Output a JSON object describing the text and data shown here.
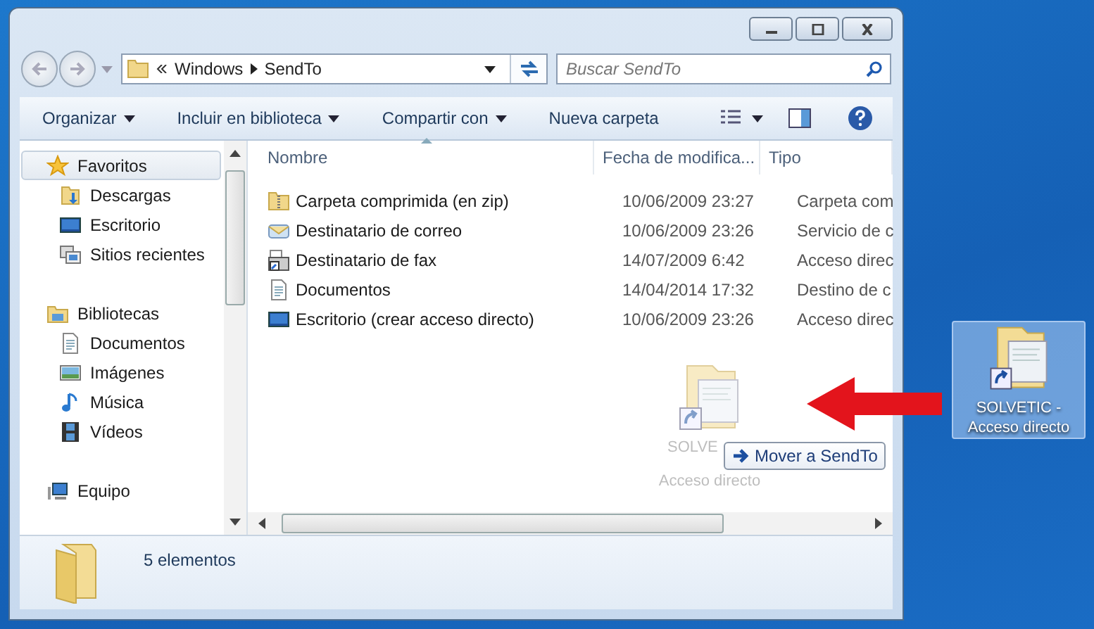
{
  "address": {
    "path": [
      "Windows",
      "SendTo"
    ]
  },
  "search": {
    "placeholder": "Buscar SendTo"
  },
  "toolbar": [
    {
      "label": "Organizar",
      "dropdown": true
    },
    {
      "label": "Incluir en biblioteca",
      "dropdown": true
    },
    {
      "label": "Compartir con",
      "dropdown": true
    },
    {
      "label": "Nueva carpeta",
      "dropdown": false
    }
  ],
  "nav": [
    {
      "label": "Favoritos",
      "kind": "star",
      "selected": true,
      "children": [
        {
          "label": "Descargas",
          "kind": "download"
        },
        {
          "label": "Escritorio",
          "kind": "desktop"
        },
        {
          "label": "Sitios recientes",
          "kind": "recent"
        }
      ]
    },
    {
      "label": "Bibliotecas",
      "kind": "library",
      "selected": false,
      "children": [
        {
          "label": "Documentos",
          "kind": "document"
        },
        {
          "label": "Imágenes",
          "kind": "image"
        },
        {
          "label": "Música",
          "kind": "music"
        },
        {
          "label": "Vídeos",
          "kind": "video"
        }
      ]
    },
    {
      "label": "Equipo",
      "kind": "computer",
      "selected": false
    }
  ],
  "columns": [
    {
      "label": "Nombre",
      "sorted": true
    },
    {
      "label": "Fecha de modifica...",
      "sorted": false
    },
    {
      "label": "Tipo",
      "sorted": false
    }
  ],
  "files": [
    {
      "name": "Carpeta comprimida (en zip)",
      "date": "10/06/2009 23:27",
      "type": "Carpeta com",
      "kind": "zip"
    },
    {
      "name": "Destinatario de correo",
      "date": "10/06/2009 23:26",
      "type": "Servicio de c",
      "kind": "mail"
    },
    {
      "name": "Destinatario de fax",
      "date": "14/07/2009 6:42",
      "type": "Acceso direc",
      "kind": "fax"
    },
    {
      "name": "Documentos",
      "date": "14/04/2014 17:32",
      "type": "Destino de c",
      "kind": "document"
    },
    {
      "name": "Escritorio (crear acceso directo)",
      "date": "10/06/2009 23:26",
      "type": "Acceso direc",
      "kind": "desktop"
    }
  ],
  "status": {
    "count": "5 elementos"
  },
  "drag": {
    "label": [
      "SOLVE",
      "Acceso directo"
    ],
    "tooltip": "Mover a SendTo"
  },
  "desktop_icon": {
    "label": "SOLVETIC - Acceso directo",
    "selected": true
  }
}
